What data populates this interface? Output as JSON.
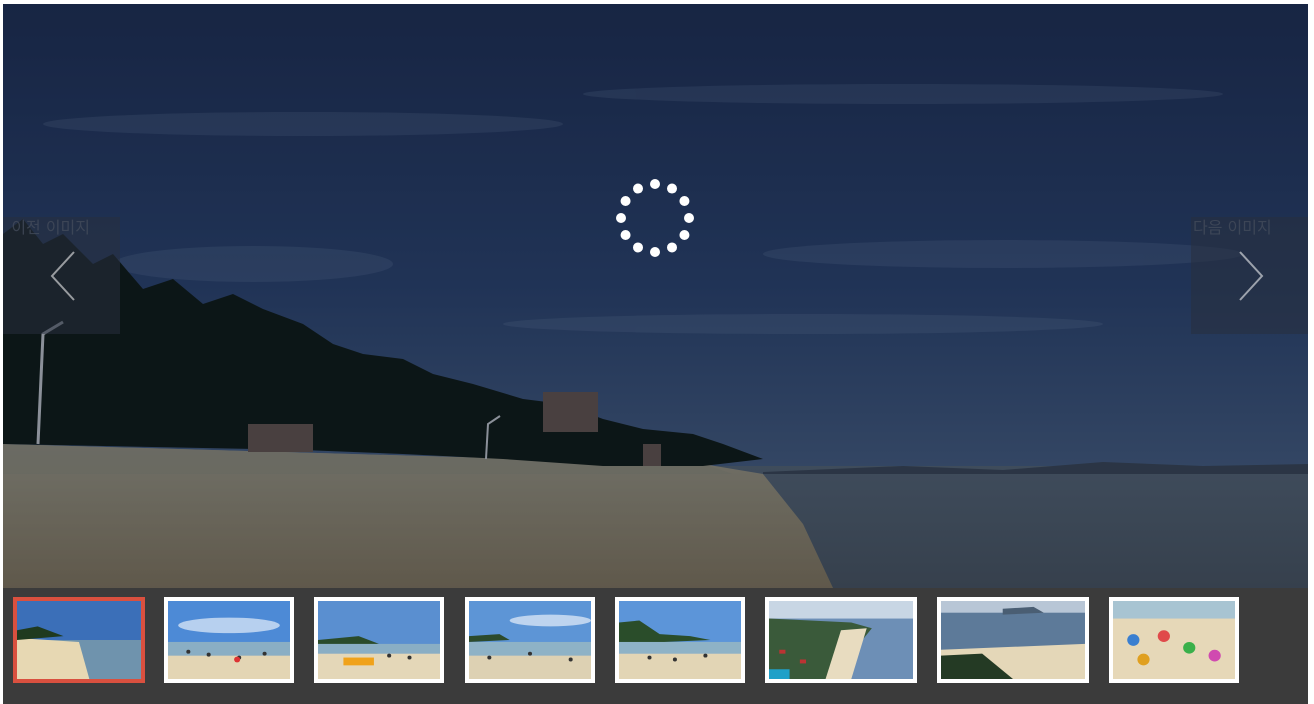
{
  "gallery": {
    "prev_label": "이전 이미지",
    "next_label": "다음 이미지",
    "prev_icon": "chevron-left-icon",
    "next_icon": "chevron-right-icon",
    "loading_icon": "loading-spinner-icon",
    "active_border_color": "#d9503f",
    "active_index": 0,
    "thumbnails": [
      {
        "kind": "beach-shore"
      },
      {
        "kind": "beach-crowd"
      },
      {
        "kind": "beach-float"
      },
      {
        "kind": "beach-waves"
      },
      {
        "kind": "beach-trees"
      },
      {
        "kind": "aerial-coast"
      },
      {
        "kind": "aerial-bay"
      },
      {
        "kind": "beach-umbrellas"
      }
    ]
  }
}
